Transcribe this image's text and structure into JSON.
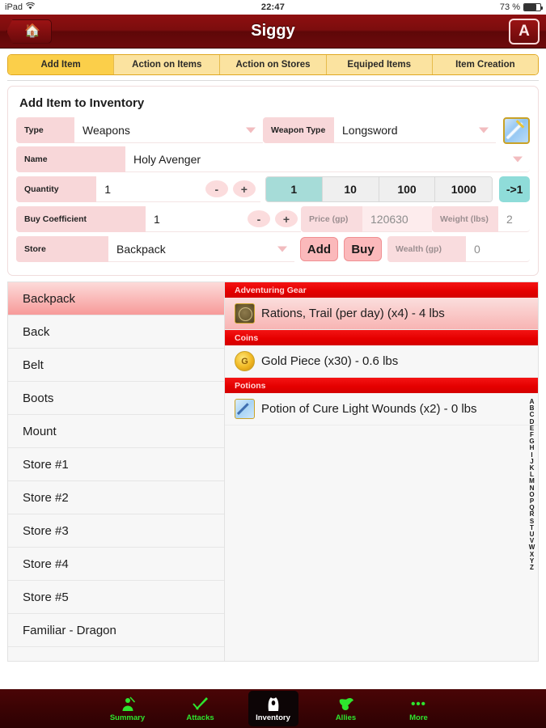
{
  "statusbar": {
    "device": "iPad",
    "wifi_icon": "wifi-icon",
    "time": "22:47",
    "battery_pct": "73 %"
  },
  "titlebar": {
    "home_icon": "home-icon",
    "title": "Siggy",
    "az_button": "A"
  },
  "tabs": [
    {
      "label": "Add Item",
      "active": true
    },
    {
      "label": "Action on Items",
      "active": false
    },
    {
      "label": "Action on Stores",
      "active": false
    },
    {
      "label": "Equiped Items",
      "active": false
    },
    {
      "label": "Item Creation",
      "active": false
    }
  ],
  "form": {
    "title": "Add Item to Inventory",
    "type_label": "Type",
    "type_value": "Weapons",
    "weapon_type_label": "Weapon Type",
    "weapon_type_value": "Longsword",
    "item_icon": "longsword-icon",
    "name_label": "Name",
    "name_value": "Holy Avenger",
    "quantity_label": "Quantity",
    "quantity_value": "1",
    "minus": "-",
    "plus": "+",
    "quantity_presets": [
      "1",
      "10",
      "100",
      "1000"
    ],
    "quantity_preset_active": "1",
    "reset_to_one": "->1",
    "buy_coefficient_label": "Buy Coefficient",
    "buy_coefficient_value": "1",
    "price_label": "Price (gp)",
    "price_value": "120630",
    "weight_label": "Weight (lbs)",
    "weight_value": "2",
    "store_label": "Store",
    "store_value": "Backpack",
    "add_button": "Add",
    "buy_button": "Buy",
    "wealth_label": "Wealth (gp)",
    "wealth_value": "0"
  },
  "stores": [
    {
      "label": "Backpack",
      "selected": true
    },
    {
      "label": "Back",
      "selected": false
    },
    {
      "label": "Belt",
      "selected": false
    },
    {
      "label": "Boots",
      "selected": false
    },
    {
      "label": "Mount",
      "selected": false
    },
    {
      "label": "Store #1",
      "selected": false
    },
    {
      "label": "Store #2",
      "selected": false
    },
    {
      "label": "Store #3",
      "selected": false
    },
    {
      "label": "Store #4",
      "selected": false
    },
    {
      "label": "Store #5",
      "selected": false
    },
    {
      "label": "Familiar - Dragon",
      "selected": false
    }
  ],
  "inventory": [
    {
      "section": "Adventuring Gear",
      "items": [
        {
          "icon": "rations-icon",
          "text": "Rations, Trail (per day) (x4) - 4 lbs",
          "highlighted": true
        }
      ]
    },
    {
      "section": "Coins",
      "items": [
        {
          "icon": "gold-coin-icon",
          "text": "Gold Piece (x30) - 0.6 lbs",
          "highlighted": false
        }
      ]
    },
    {
      "section": "Potions",
      "items": [
        {
          "icon": "potion-icon",
          "text": "Potion of Cure Light Wounds (x2) - 0 lbs",
          "highlighted": false
        }
      ]
    }
  ],
  "alpha_index": [
    "A",
    "B",
    "C",
    "D",
    "E",
    "F",
    "G",
    "H",
    "I",
    "J",
    "K",
    "L",
    "M",
    "N",
    "O",
    "P",
    "Q",
    "R",
    "S",
    "T",
    "U",
    "V",
    "W",
    "X",
    "Y",
    "Z"
  ],
  "bottom_tabs": [
    {
      "label": "Summary",
      "icon": "character-summary-icon",
      "glyph": "♟",
      "active": false
    },
    {
      "label": "Attacks",
      "icon": "sword-icon",
      "glyph": "⚔",
      "active": false
    },
    {
      "label": "Inventory",
      "icon": "bag-icon",
      "glyph": "♟",
      "active": true
    },
    {
      "label": "Allies",
      "icon": "dragon-icon",
      "glyph": "❦",
      "active": false
    },
    {
      "label": "More",
      "icon": "more-dots-icon",
      "glyph": "•••",
      "active": false
    }
  ],
  "colors": {
    "header_red": "#7c0d0e",
    "tab_gold": "#fbcf4a",
    "section_red": "#e50000",
    "accent_teal": "#8fdcd9",
    "accent_pink": "#fbb9bb",
    "tabbar_green": "#2ee52e"
  }
}
